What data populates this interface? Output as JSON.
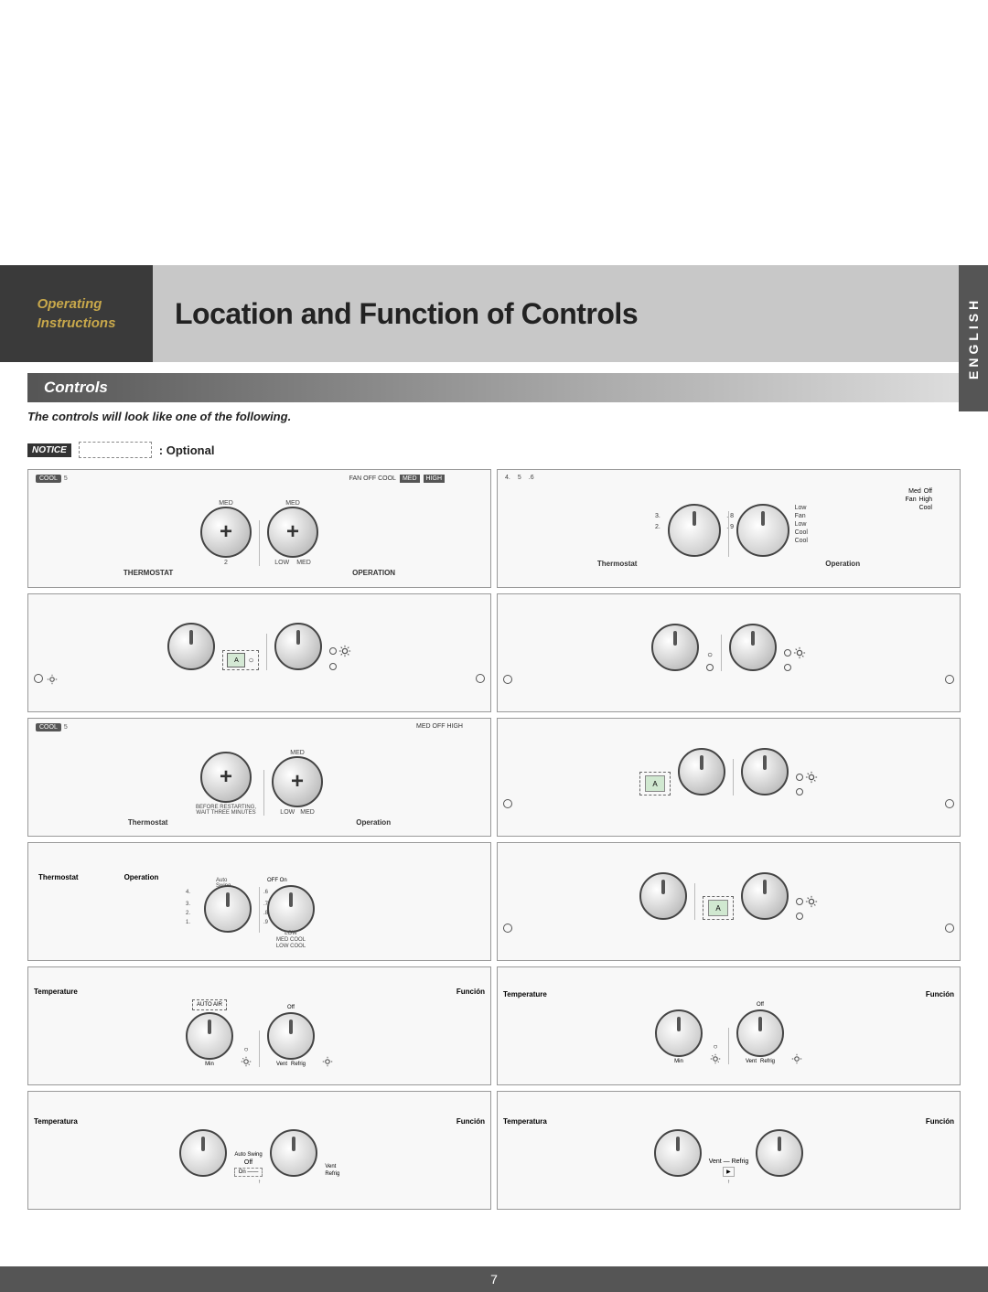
{
  "header": {
    "left_line1": "Operating",
    "left_line2": "Instructions",
    "right_title": "Location and Function of Controls"
  },
  "controls_section": {
    "label": "Controls",
    "description": "The controls will look like one of the following.",
    "notice_label": "NOTICE",
    "optional_label": ": Optional"
  },
  "panels": [
    {
      "id": "p1",
      "type": "plus-knobs",
      "labels": [
        "THERMOSTAT",
        "OPERATION"
      ],
      "top_badge": ""
    },
    {
      "id": "p2",
      "type": "dial-knobs",
      "labels": [
        "Thermostat",
        "Operation"
      ],
      "top_badge": ""
    },
    {
      "id": "p3",
      "type": "knobs-lcd",
      "labels": [
        "",
        ""
      ],
      "top_badge": ""
    },
    {
      "id": "p4",
      "type": "knobs-simple-right",
      "labels": [
        "",
        ""
      ],
      "top_badge": ""
    },
    {
      "id": "p5",
      "type": "plus-knobs-labeled",
      "labels": [
        "Thermostat",
        "Operation"
      ],
      "sub": "BEFORE RESTARTING, WAIT THREE MINUTES"
    },
    {
      "id": "p6",
      "type": "dashed-lcd-knobs",
      "labels": [
        "",
        ""
      ],
      "top_badge": ""
    },
    {
      "id": "p7",
      "type": "thermostat-operation-dial",
      "labels": [
        "Thermostat",
        "Operation"
      ],
      "top_badge": ""
    },
    {
      "id": "p8",
      "type": "dashed-lcd-knobs2",
      "labels": [
        "",
        ""
      ],
      "top_badge": ""
    },
    {
      "id": "p9",
      "type": "temperature-funcion",
      "labels": [
        "Temperature",
        "Función"
      ],
      "dashed": true
    },
    {
      "id": "p10",
      "type": "temperature-funcion",
      "labels": [
        "Temperature",
        "Función"
      ],
      "dashed": false
    },
    {
      "id": "p11",
      "type": "temperatura-funcion-bottom",
      "labels": [
        "Temperatura",
        "Función"
      ],
      "extra": "Auto Swing"
    },
    {
      "id": "p12",
      "type": "temperatura-funcion-bottom2",
      "labels": [
        "Temperatura",
        "Función"
      ],
      "extra": ""
    }
  ],
  "footer": {
    "page_number": "7"
  },
  "sidebar": {
    "label": "ENGLISH"
  }
}
